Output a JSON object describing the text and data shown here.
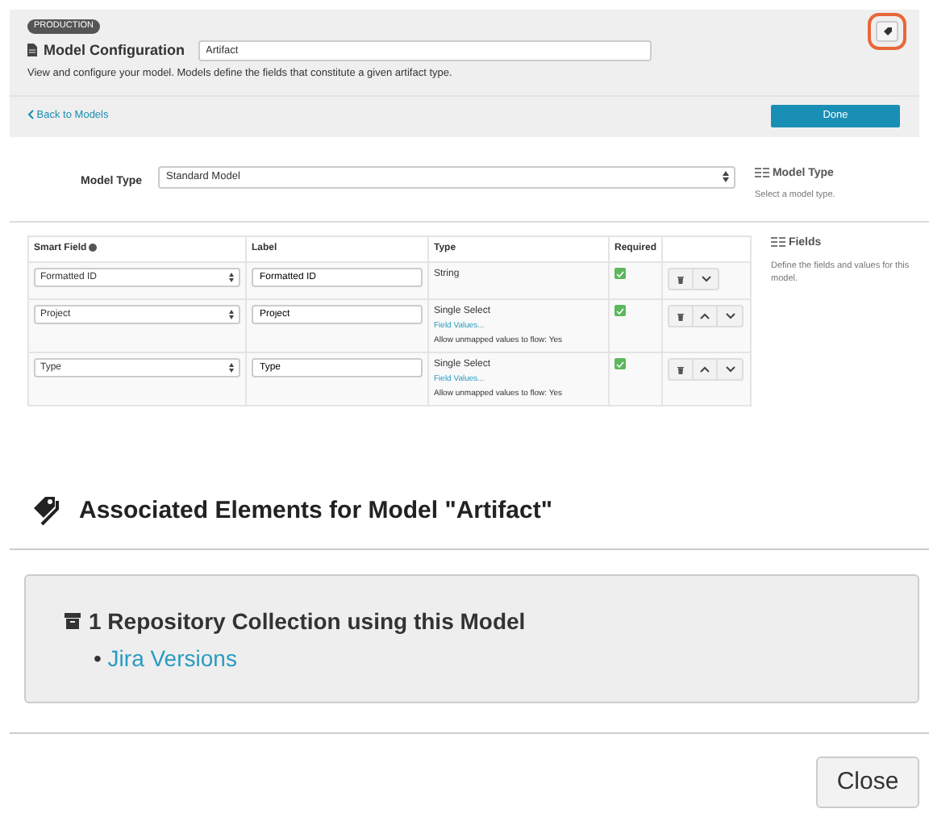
{
  "header": {
    "badge": "PRODUCTION",
    "title": "Model Configuration",
    "name_value": "Artifact",
    "description": "View and configure your model. Models define the fields that constitute a given artifact type.",
    "highlighted": true
  },
  "nav": {
    "back_link": "Back to Models",
    "done_button": "Done"
  },
  "model_type": {
    "label": "Model Type",
    "value": "Standard Model",
    "help_title": "Model Type",
    "help_text": "Select a model type."
  },
  "fields_table": {
    "columns": [
      "Smart Field",
      "Label",
      "Type",
      "Required"
    ],
    "rows": [
      {
        "smart_field": "Formatted ID",
        "label": "Formatted ID",
        "type": "String",
        "required": true,
        "can_move_up": false
      },
      {
        "smart_field": "Project",
        "label": "Project",
        "type": "Single Select",
        "field_values_link": "Field Values...",
        "note": "Allow unmapped values to flow: Yes",
        "required": true,
        "can_move_up": true
      },
      {
        "smart_field": "Type",
        "label": "Type",
        "type": "Single Select",
        "field_values_link": "Field Values...",
        "note": "Allow unmapped values to flow: Yes",
        "required": true,
        "can_move_up": true
      }
    ],
    "help_title": "Fields",
    "help_text": "Define the fields and values for this model."
  },
  "associated": {
    "heading": "Associated Elements for Model \"Artifact\"",
    "collection_title": "1 Repository Collection using this Model",
    "items": [
      {
        "marker": "•",
        "text": "Jira Versions"
      }
    ]
  },
  "close_button": "Close"
}
